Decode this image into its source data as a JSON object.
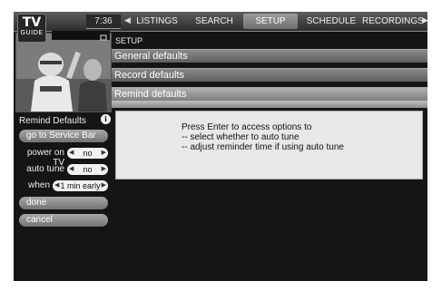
{
  "logo": {
    "top": "TV",
    "bottom": "GUIDE"
  },
  "clock": "7:36",
  "nav": {
    "items": [
      {
        "label": "LISTINGS"
      },
      {
        "label": "SEARCH"
      },
      {
        "label": "SETUP",
        "active": true
      },
      {
        "label": "SCHEDULE"
      },
      {
        "label": "RECORDINGS"
      }
    ]
  },
  "setup": {
    "label": "SETUP",
    "menu": [
      "General defaults",
      "Record defaults",
      "Remind defaults"
    ],
    "panel_lines": [
      "Press Enter to access options to",
      "-- select whether to auto tune",
      "-- adjust reminder time if using auto tune"
    ]
  },
  "left_menu": {
    "title": "Remind Defaults",
    "info_icon": "i",
    "service_bar": "go to Service Bar",
    "power_on_tv": {
      "label": "power on TV",
      "value": "no"
    },
    "auto_tune": {
      "label": "auto tune",
      "value": "no"
    },
    "when": {
      "label": "when",
      "value": "1 min early"
    },
    "done": "done",
    "cancel": "cancel"
  }
}
